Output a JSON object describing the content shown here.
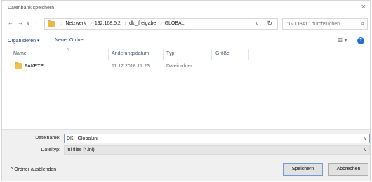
{
  "window": {
    "title": "Datenbank speichern"
  },
  "address": {
    "crumbs": [
      "Netzwerk",
      "192.168.5.2",
      "dki_freigabe",
      "GLOBAL"
    ],
    "search_placeholder": "\"GLOBAL\" durchsuchen"
  },
  "toolbar": {
    "organize": "Organisieren ▾",
    "new_folder": "Neuer Ordner"
  },
  "columns": {
    "name": "Name",
    "modified": "Änderungsdatum",
    "type": "Typ",
    "size": "Größe"
  },
  "files": [
    {
      "name": "PAKETE",
      "modified": "11.12.2018 17:23",
      "type": "Dateiordner",
      "size": "",
      "icon": "folder-icon"
    }
  ],
  "form": {
    "filename_label": "Dateiname:",
    "filename_value": "DKI_Global.ini",
    "filetype_label": "Dateityp:",
    "filetype_value": "ini files (*.ini)"
  },
  "footer": {
    "hide_folders": "Ordner ausblenden",
    "save_button": "Speichern",
    "cancel_button": "Abbrechen"
  }
}
